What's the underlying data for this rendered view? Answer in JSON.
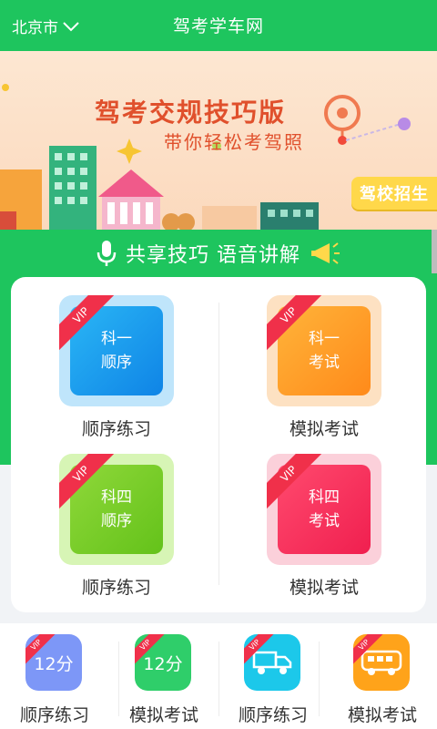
{
  "header": {
    "city": "北京市",
    "title": "驾考学车网"
  },
  "banner": {
    "title": "驾考交规技巧版",
    "subtitle": "带你轻松考驾照",
    "badge": "驾校招生"
  },
  "slogan": "共享技巧 语音讲解",
  "tiles": [
    {
      "vip": "VIP",
      "line1": "科一",
      "line2": "顺序",
      "label": "顺序练习"
    },
    {
      "vip": "VIP",
      "line1": "科一",
      "line2": "考试",
      "label": "模拟考试"
    },
    {
      "vip": "VIP",
      "line1": "科四",
      "line2": "顺序",
      "label": "顺序练习"
    },
    {
      "vip": "VIP",
      "line1": "科四",
      "line2": "考试",
      "label": "模拟考试"
    }
  ],
  "bottom_items": [
    {
      "vip": "VIP",
      "icon_text": "12分",
      "icon": "text-icon",
      "label": "顺序练习"
    },
    {
      "vip": "VIP",
      "icon_text": "12分",
      "icon": "text-icon",
      "label": "模拟考试"
    },
    {
      "vip": "VIP",
      "icon_text": "",
      "icon": "truck-icon",
      "label": "顺序练习"
    },
    {
      "vip": "VIP",
      "icon_text": "",
      "icon": "bus-icon",
      "label": "模拟考试"
    }
  ],
  "colors": {
    "primary_green": "#1ec55e",
    "banner_text": "#e0502c",
    "vip_ribbon": "#f0304a"
  }
}
